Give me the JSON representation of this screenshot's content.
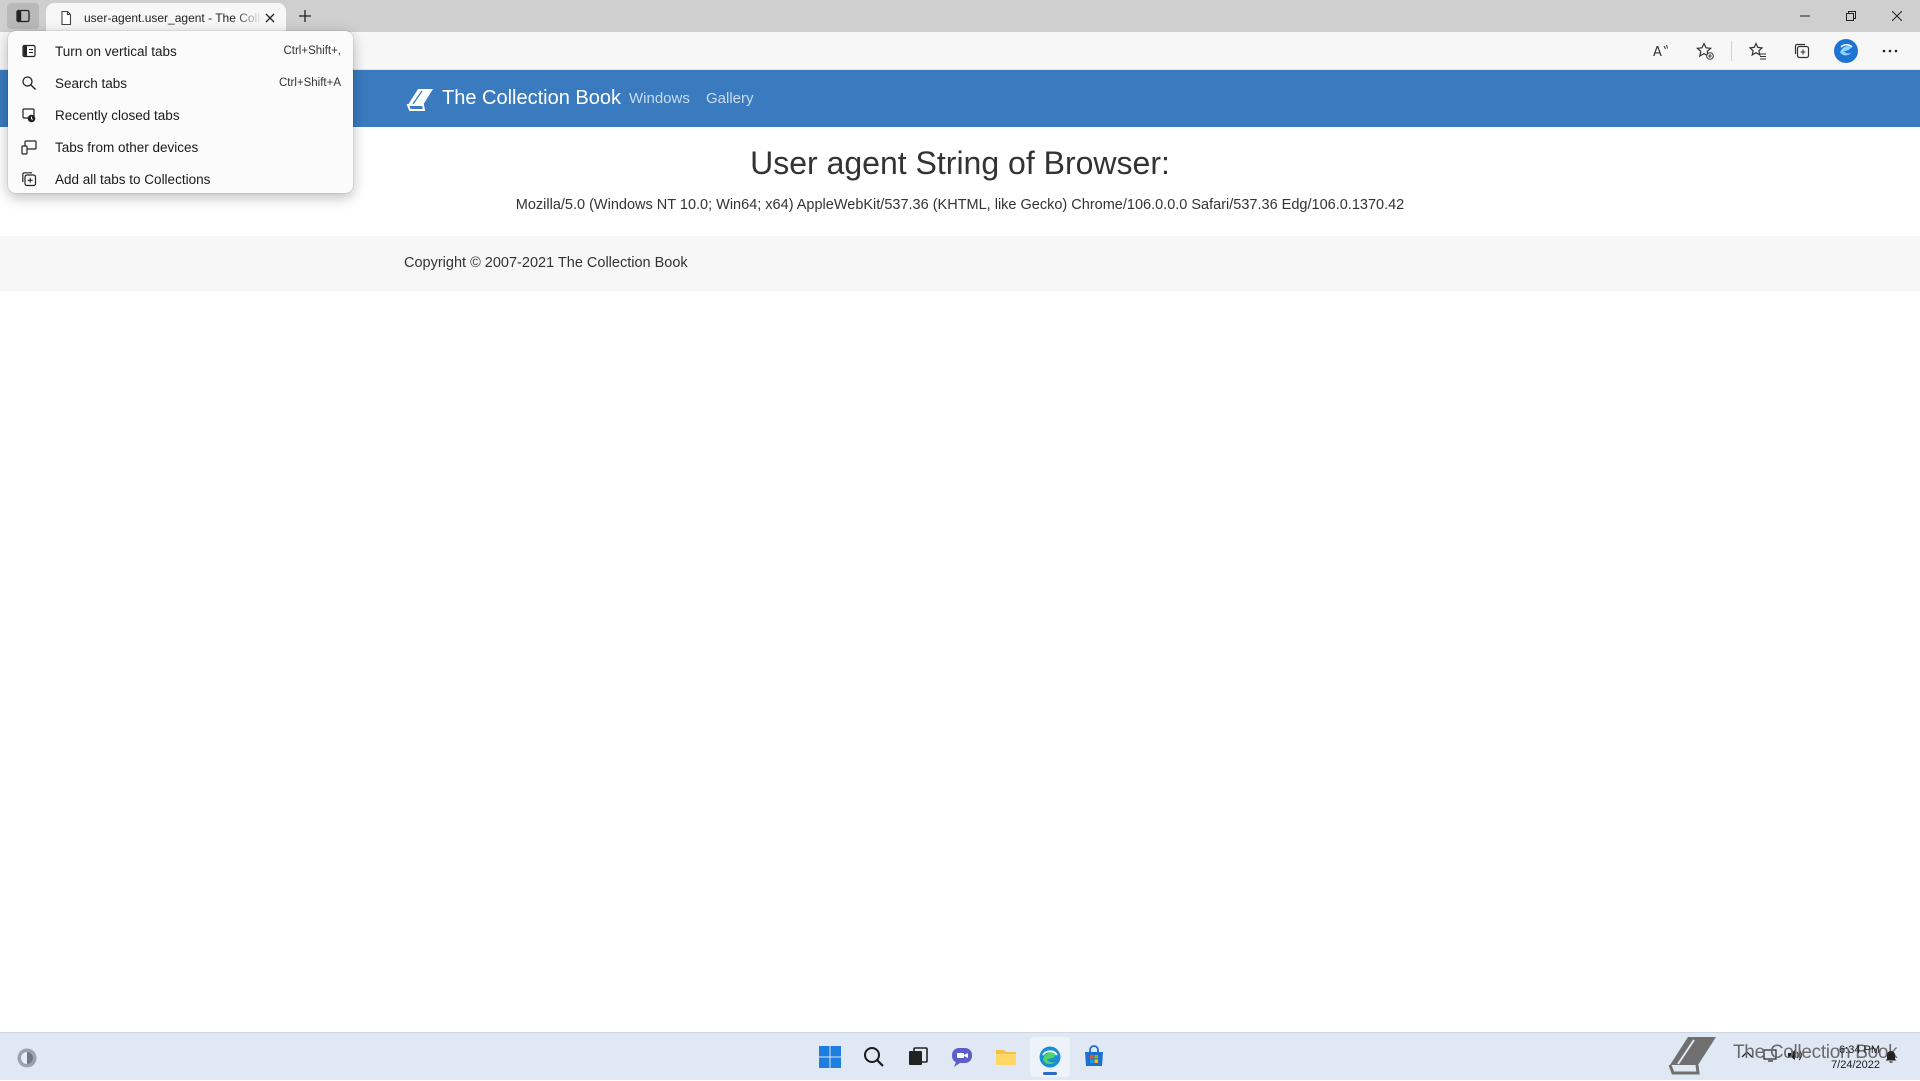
{
  "browser": {
    "tab": {
      "title": "user-agent.user_agent - The Collection Book"
    },
    "toolbar_icons": [
      "read-aloud-icon",
      "add-favorite-icon",
      "favorites-icon",
      "collections-icon",
      "profile-icon",
      "more-icon"
    ]
  },
  "tab_menu": {
    "items": [
      {
        "label": "Turn on vertical tabs",
        "shortcut": "Ctrl+Shift+,",
        "icon": "vertical-tabs-icon"
      },
      {
        "label": "Search tabs",
        "shortcut": "Ctrl+Shift+A",
        "icon": "search-icon"
      },
      {
        "label": "Recently closed tabs",
        "shortcut": "",
        "icon": "recently-closed-icon"
      },
      {
        "label": "Tabs from other devices",
        "shortcut": "",
        "icon": "devices-icon"
      },
      {
        "label": "Add all tabs to Collections",
        "shortcut": "",
        "icon": "collections-icon"
      }
    ]
  },
  "site": {
    "brand": "The Collection Book",
    "nav": {
      "windows": "Windows",
      "gallery": "Gallery"
    },
    "heading": "User agent String of Browser:",
    "ua_string": "Mozilla/5.0 (Windows NT 10.0; Win64; x64) AppleWebKit/537.36 (KHTML, like Gecko) Chrome/106.0.0.0 Safari/537.36 Edg/106.0.1370.42",
    "copyright": "Copyright © 2007-2021 The Collection Book"
  },
  "taskbar": {
    "apps": [
      "start-icon",
      "search-icon",
      "task-view-icon",
      "chat-icon",
      "file-explorer-icon",
      "edge-icon",
      "store-icon"
    ],
    "active_app": "edge-icon",
    "watermark_text": "The Collection Book",
    "time": "6:34 PM",
    "date": "7/24/2022"
  },
  "colors": {
    "site_nav": "#3a7bbf",
    "taskbar": "#dfe8f3",
    "accent": "#2b6ac4"
  }
}
